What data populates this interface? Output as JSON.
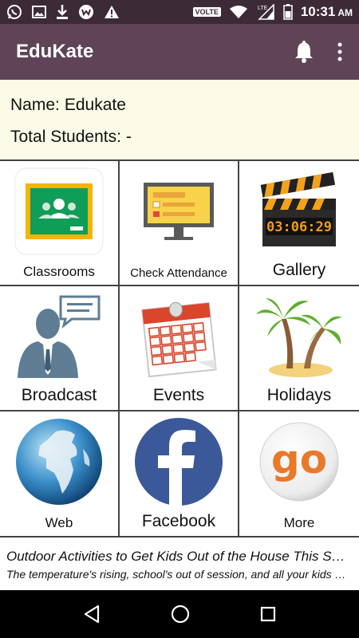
{
  "status_bar": {
    "network_badge": "VOLTE",
    "lte_label": "LTE",
    "time": "10:31",
    "ampm": "AM",
    "icons": [
      "whatsapp-icon",
      "image-icon",
      "download-icon",
      "wechat-icon",
      "warning-icon",
      "wifi-icon",
      "signal-icon",
      "battery-icon"
    ]
  },
  "app_bar": {
    "title": "EduKate",
    "actions": [
      "bell-icon",
      "overflow-menu-icon"
    ],
    "color": "#5e4456"
  },
  "info": {
    "name_label": "Name:",
    "name_value": "Edukate",
    "students_label": "Total Students:",
    "students_value": "-"
  },
  "tiles": [
    {
      "label": "Classrooms",
      "icon": "google-classroom-icon"
    },
    {
      "label": "Check Attendance",
      "icon": "attendance-monitor-icon"
    },
    {
      "label": "Gallery",
      "icon": "clapperboard-icon",
      "timer": "03:06:29"
    },
    {
      "label": "Broadcast",
      "icon": "speaker-person-icon"
    },
    {
      "label": "Events",
      "icon": "calendar-icon"
    },
    {
      "label": "Holidays",
      "icon": "palm-trees-icon"
    },
    {
      "label": "Web",
      "icon": "globe-icon"
    },
    {
      "label": "Facebook",
      "icon": "facebook-icon"
    },
    {
      "label": "More",
      "icon": "go-icon",
      "logo_text": "go"
    }
  ],
  "news": {
    "title": "Outdoor Activities to Get Kids Out of the House This Summer",
    "body": "The temperature's rising, school's out of session, and all your kids want to do is stay inside"
  },
  "nav_bar": {
    "icons": [
      "back-icon",
      "home-icon",
      "recents-icon"
    ]
  }
}
